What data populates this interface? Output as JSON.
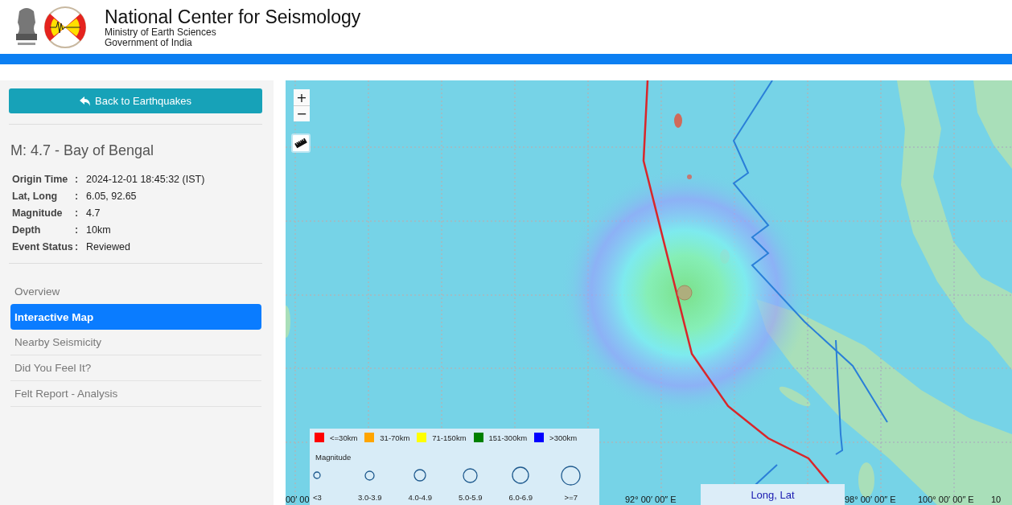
{
  "header": {
    "title": "National Center for Seismology",
    "subtitle_lines": [
      "Ministry of Earth Sciences",
      "Government of India"
    ]
  },
  "sidebar": {
    "back_button": "Back to Earthquakes",
    "event_title": "M: 4.7 - Bay of Bengal",
    "details": [
      {
        "label": "Origin Time",
        "separator": ":",
        "value": "2024-12-01 18:45:32 (IST)"
      },
      {
        "label": "Lat, Long",
        "separator": ":",
        "value": "6.05, 92.65"
      },
      {
        "label": "Magnitude",
        "separator": ":",
        "value": "4.7"
      },
      {
        "label": "Depth",
        "separator": ":",
        "value": "10km"
      },
      {
        "label": "Event Status",
        "separator": ":",
        "value": "Reviewed"
      }
    ],
    "nav": [
      {
        "label": "Overview",
        "selected": false
      },
      {
        "label": "Interactive Map",
        "selected": true
      },
      {
        "label": "Nearby Seismicity",
        "selected": false
      },
      {
        "label": "Did You Feel It?",
        "selected": false
      },
      {
        "label": "Felt Report - Analysis",
        "selected": false
      }
    ]
  },
  "map": {
    "zoom_in": "+",
    "zoom_out": "−",
    "axis_labels": [
      "00′ 00",
      "92° 00′ 00″ E",
      "98° 00′ 00″ E",
      "100° 00′ 00″ E",
      "10"
    ],
    "legend": {
      "depth": [
        {
          "label": "<=30km",
          "color": "#ff0000"
        },
        {
          "label": "31-70km",
          "color": "#ffa500"
        },
        {
          "label": "71-150km",
          "color": "#ffff00"
        },
        {
          "label": "151-300km",
          "color": "#008000"
        },
        {
          "label": ">300km",
          "color": "#0000ff"
        }
      ],
      "magnitude_title": "Magnitude",
      "magnitude": [
        "<3",
        "3.0-3.9",
        "4.0-4.9",
        "5.0-5.9",
        "6.0-6.9",
        ">=7"
      ]
    },
    "coordinate_box": "Long, Lat"
  }
}
